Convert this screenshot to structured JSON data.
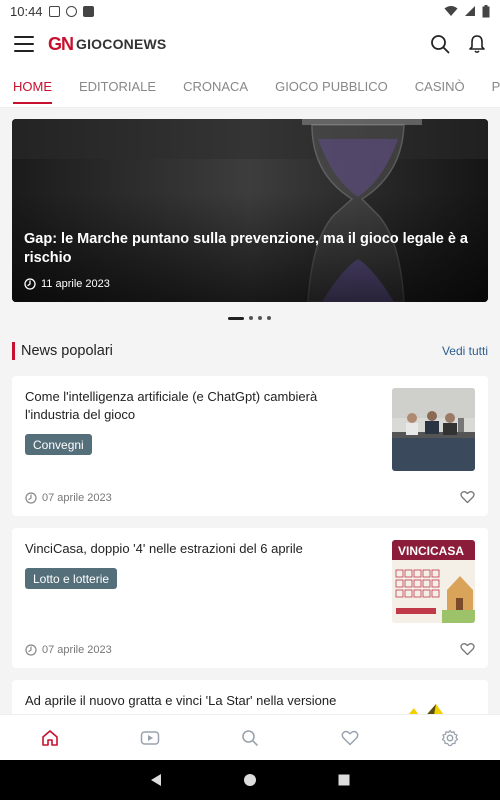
{
  "status_bar": {
    "time": "10:44"
  },
  "header": {
    "logo_mark": "GN",
    "logo_text": "GIOCONEWS"
  },
  "tabs": [
    {
      "label": "HOME",
      "active": true
    },
    {
      "label": "EDITORIALE",
      "active": false
    },
    {
      "label": "CRONACA",
      "active": false
    },
    {
      "label": "GIOCO PUBBLICO",
      "active": false
    },
    {
      "label": "CASINÒ",
      "active": false
    },
    {
      "label": "POKER",
      "active": false
    }
  ],
  "hero": {
    "title": "Gap: le Marche puntano sulla prevenzione, ma il gioco legale è a rischio",
    "date": "11 aprile 2023"
  },
  "carousel": {
    "count": 4,
    "active_index": 0
  },
  "popular": {
    "title": "News popolari",
    "link": "Vedi tutti",
    "items": [
      {
        "title": "Come l'intelligenza artificiale (e ChatGpt) cambierà l'industria del gioco",
        "tag": "Convegni",
        "date": "07 aprile 2023"
      },
      {
        "title": "VinciCasa, doppio '4' nelle estrazioni del 6 aprile",
        "tag": "Lotto e lotterie",
        "date": "07 aprile 2023",
        "thumb_logo": "VINCICASA"
      },
      {
        "title": "Ad aprile il nuovo gratta e vinci 'La Star' nella versione"
      }
    ]
  },
  "bottom_nav": [
    "home-icon",
    "video-icon",
    "search-icon",
    "heart-icon",
    "settings-icon"
  ],
  "colors": {
    "accent": "#c8102e",
    "tag_bg": "#546e7a",
    "link": "#2a5d8f"
  }
}
